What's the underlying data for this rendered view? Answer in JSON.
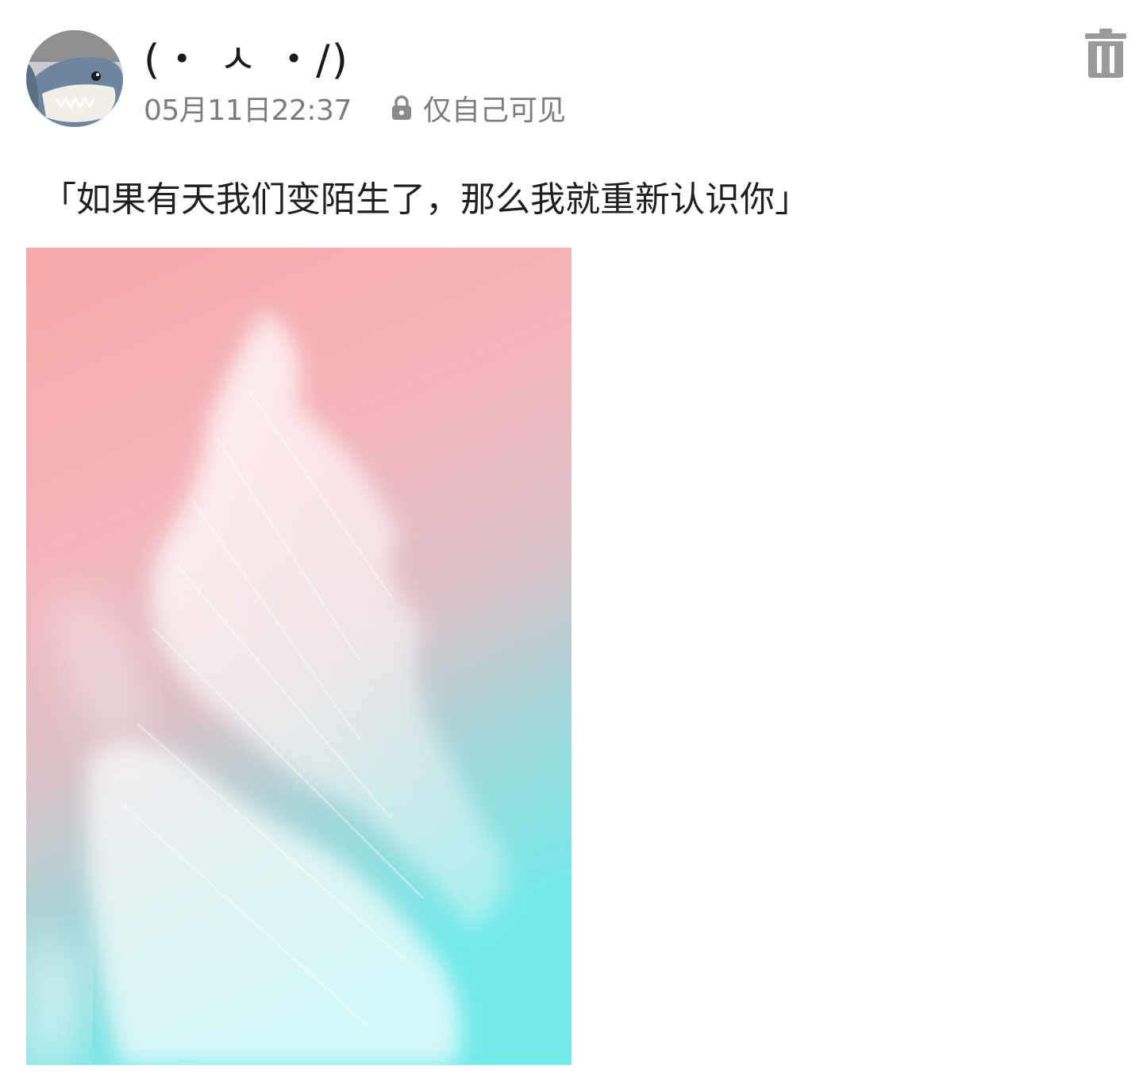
{
  "post": {
    "username": "(・ ㅅ ・/)",
    "timestamp": "05月11日22:37",
    "privacy_label": "仅自己可见",
    "text": "「如果有天我们变陌生了，那么我就重新认识你」"
  },
  "icons": {
    "avatar": "shark-plush-avatar",
    "privacy": "lock-icon",
    "delete": "trash-icon"
  },
  "image": {
    "description_colors": [
      "#f6abad",
      "#e8c0c4",
      "#7fe3e6"
    ]
  }
}
